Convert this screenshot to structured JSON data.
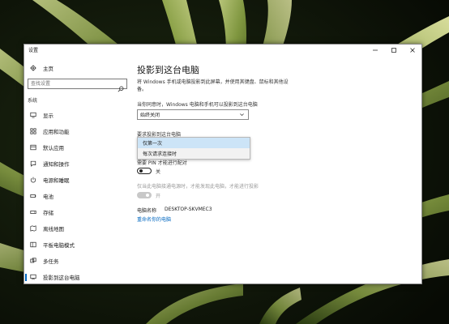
{
  "window": {
    "title": "设置"
  },
  "colors": {
    "accent": "#0067c0",
    "selected_option_bg": "#cce4f7",
    "sidebar_active_bar": "#0067c0"
  },
  "sidebar": {
    "home": {
      "label": "主页",
      "icon": "gear-icon"
    },
    "search": {
      "placeholder": "查找设置",
      "icon": "search-icon"
    },
    "section": "系统",
    "items": [
      {
        "label": "显示",
        "icon": "monitor-icon"
      },
      {
        "label": "应用和功能",
        "icon": "apps-icon"
      },
      {
        "label": "默认应用",
        "icon": "default-apps-icon"
      },
      {
        "label": "通知和操作",
        "icon": "notifications-icon"
      },
      {
        "label": "电源和睡眠",
        "icon": "power-icon"
      },
      {
        "label": "电池",
        "icon": "battery-icon"
      },
      {
        "label": "存储",
        "icon": "storage-icon"
      },
      {
        "label": "离线地图",
        "icon": "map-icon"
      },
      {
        "label": "平板电脑模式",
        "icon": "tablet-icon"
      },
      {
        "label": "多任务",
        "icon": "multitask-icon"
      },
      {
        "label": "投影到这台电脑",
        "icon": "projecting-icon",
        "active": true
      }
    ]
  },
  "content": {
    "title": "投影到这台电脑",
    "description": "将 Windows 手机或电脑投影到此屏幕，并使用其键盘、鼠标和其他设备。",
    "allow_label": "当你同意时，Windows 电脑和手机可以投影到这台电脑",
    "allow_value": "始终关闭",
    "ask_label": "要求投影到这台电脑",
    "ask_options": [
      "仅第一次",
      "每次请求连接时"
    ],
    "ask_selected": "仅第一次",
    "pin_label_partial": "需要 PIN 才能进行配对",
    "pin_toggle_text": "关",
    "power_label": "仅当此电脑接通电源时，才能发现此电脑，才能进行投影",
    "power_toggle_text": "开",
    "pc_name_key": "电脑名称",
    "pc_name_value": "DESKTOP-SKVMEC3",
    "rename_link": "重命名你的电脑"
  }
}
